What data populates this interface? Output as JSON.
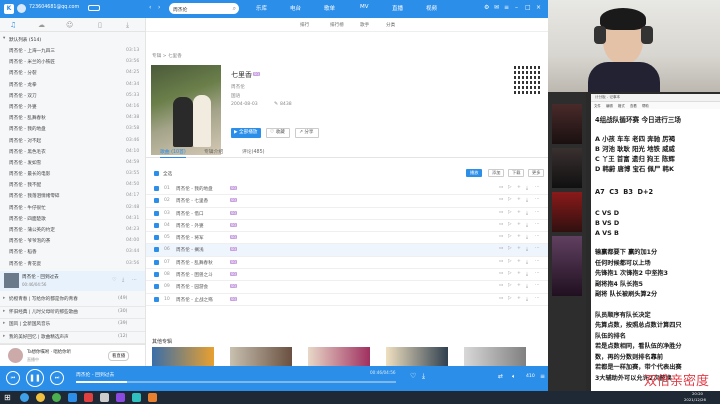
{
  "titlebar": {
    "account": "723604681@qq.com",
    "search_text": "周杰伦",
    "nav_tabs": [
      "乐库",
      "电台",
      "歌单",
      "MV",
      "直播",
      "视频"
    ],
    "sub_tabs": [
      "排行",
      "排行榜",
      "歌手",
      "分类"
    ]
  },
  "sidebar": {
    "section_title": "默认列表 (514)",
    "songs": [
      {
        "name": "周杰伦 - 上海一九四三",
        "dur": "03:13"
      },
      {
        "name": "周杰伦 - 米兰的小铁匠",
        "dur": "03:56"
      },
      {
        "name": "周杰伦 - 分裂",
        "dur": "04:25"
      },
      {
        "name": "周杰伦 - 龙拳",
        "dur": "04:34"
      },
      {
        "name": "周杰伦 - 双刀",
        "dur": "05:33"
      },
      {
        "name": "周杰伦 - 外婆",
        "dur": "04:16"
      },
      {
        "name": "周杰伦 - 乱舞春秋",
        "dur": "04:38"
      },
      {
        "name": "周杰伦 - 我的地盘",
        "dur": "03:58"
      },
      {
        "name": "周杰伦 - 对不起",
        "dur": "03:46"
      },
      {
        "name": "周杰伦 - 黑色毛衣",
        "dur": "04:10"
      },
      {
        "name": "周杰伦 - 发如雪",
        "dur": "04:59"
      },
      {
        "name": "周杰伦 - 最长的电影",
        "dur": "03:55"
      },
      {
        "name": "周杰伦 - 我不配",
        "dur": "04:50"
      },
      {
        "name": "周杰伦 - 我落泪情绪零碎",
        "dur": "04:17"
      },
      {
        "name": "周杰伦 - 牛仔很忙",
        "dur": "02:48"
      },
      {
        "name": "周杰伦 - 四面楚歌",
        "dur": "04:31"
      },
      {
        "name": "周杰伦 - 蒲公英的约定",
        "dur": "04:23"
      },
      {
        "name": "周杰伦 - 爷爷泡的茶",
        "dur": "04:00"
      },
      {
        "name": "周杰伦 - 稻香",
        "dur": "03:44"
      },
      {
        "name": "周杰伦 - 青花瓷",
        "dur": "03:56"
      }
    ],
    "now_playing": {
      "name": "周杰伦 - 回到过去",
      "time": "00:46/04:56"
    },
    "lists": [
      {
        "name": "奶橙青春 | 写给你的都是你的青春",
        "count": "(49)"
      },
      {
        "name": "怀旧经典 | 儿时父母听的那些歌曲",
        "count": "(30)"
      },
      {
        "name": "国风 | 全新国风音乐",
        "count": "(39)"
      },
      {
        "name": "我的美好回忆 | 歌曲精选声声",
        "count": "(12)"
      }
    ],
    "user_name": "Ta想你嘱咐 · 唱给你听",
    "user_status": "直播中",
    "user_button": "看直播"
  },
  "main": {
    "breadcrumb": "专辑 > 七里香",
    "album_title": "七里香",
    "album_badge": "SQ",
    "artist": "周杰伦",
    "language": "国语",
    "date": "2004-08-03",
    "comment_count": "8438",
    "play_all": "全部播放",
    "favorite": "收藏",
    "share": "分享",
    "tabs": [
      "歌曲 (10首)",
      "专辑介绍",
      "评论(485)"
    ],
    "select_all": "全选",
    "toolbar_buttons": [
      "播放",
      "添加",
      "下载",
      "更多"
    ],
    "songs": [
      {
        "no": "01",
        "name": "周杰伦 - 我的地盘"
      },
      {
        "no": "02",
        "name": "周杰伦 - 七里香"
      },
      {
        "no": "03",
        "name": "周杰伦 - 借口"
      },
      {
        "no": "04",
        "name": "周杰伦 - 外婆"
      },
      {
        "no": "05",
        "name": "周杰伦 - 将军"
      },
      {
        "no": "06",
        "name": "周杰伦 - 搁浅"
      },
      {
        "no": "07",
        "name": "周杰伦 - 乱舞春秋"
      },
      {
        "no": "08",
        "name": "周杰伦 - 困兽之斗"
      },
      {
        "no": "09",
        "name": "周杰伦 - 园游会"
      },
      {
        "no": "10",
        "name": "周杰伦 - 止战之殇"
      }
    ],
    "other_albums_title": "其他专辑"
  },
  "player": {
    "song": "周杰伦 - 回到过去",
    "time": "00:46/04:56",
    "volume": "410",
    "progress": 0.16
  },
  "rightpane": {
    "notepad_title": "计分板 - 记事本",
    "notepad_menu": [
      "文件",
      "编辑",
      "格式",
      "查看",
      "帮助"
    ],
    "heading": "4组战队循环赛 今日进行三场",
    "teams": [
      "A 小孩 车车 老四 奔驰 厉褐",
      "B 河池 耿耿 阳光 地铁 威威",
      "C 丫王 首富 遗归 狗王 陈辉",
      "D 韩蔚 唐博 宝石 佩尸 韩K"
    ],
    "score": "A7  C3  B3  D+2",
    "matches": [
      "C VS D",
      "B VS D",
      "A VS B"
    ],
    "rules": [
      "输赢都要下 赢的加1分",
      "任何时候都可以上场",
      "先锋抱1 次锋抱2 中坚抱3",
      "副将抱4 队长抱5",
      "副将 队长被刷头算2分"
    ],
    "rules2": [
      "队员顺序有队长决定",
      "先算点数，按照总点数计算四只",
      "队伍的排名",
      "若是点数相同，看队伍的净胜分",
      "数，再的分数则排名靠前",
      "若都是一样加赛，带个代表出赛",
      "3大辅助外可以允许2次替换"
    ],
    "watermark": "双倍亲密度"
  },
  "taskbar": {
    "time": "20:20",
    "date": "2021/12/26"
  },
  "colors": {
    "accent": "#2b8ee8",
    "notepad_text": "#1a1a1a",
    "watermark": "#e0404a"
  }
}
